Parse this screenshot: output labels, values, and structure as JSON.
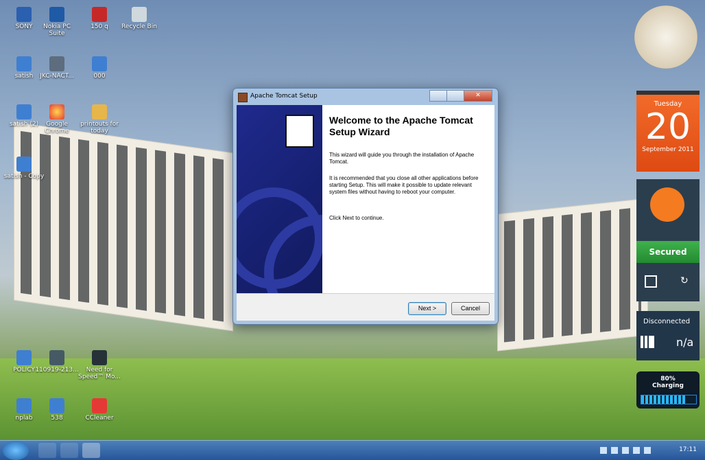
{
  "desktop_icons": [
    {
      "label": "SONY"
    },
    {
      "label": "Nokia PC\nSuite"
    },
    {
      "label": "150 q"
    },
    {
      "label": "Recycle Bin"
    },
    {
      "label": "satish"
    },
    {
      "label": "JKC-NACT..."
    },
    {
      "label": "000"
    },
    {
      "label": "satish (2)"
    },
    {
      "label": "Google\nChrome"
    },
    {
      "label": "printouts for\ntoday"
    },
    {
      "label": "satish - Copy"
    },
    {
      "label": "POLICY"
    },
    {
      "label": "110919-213..."
    },
    {
      "label": "Need for\nSpeed™ Mo..."
    },
    {
      "label": "nplab"
    },
    {
      "label": "538"
    },
    {
      "label": "CCleaner"
    }
  ],
  "dialog": {
    "title": "Apache Tomcat Setup",
    "heading": "Welcome to the Apache Tomcat Setup Wizard",
    "paragraphs": [
      "This wizard will guide you through the installation of Apache Tomcat.",
      "It is recommended that you close all other applications before starting Setup. This will make it possible to update relevant system files without having to reboot your computer.",
      "Click Next to continue."
    ],
    "buttons": {
      "next": "Next >",
      "cancel": "Cancel"
    }
  },
  "gadgets": {
    "calendar": {
      "weekday": "Tuesday",
      "day": "20",
      "month_year": "September 2011"
    },
    "avast": {
      "status": "Secured"
    },
    "network": {
      "status": "Disconnected",
      "value": "n/a"
    },
    "battery": {
      "percent": "80%",
      "state": "Charging",
      "level": 0.8
    }
  },
  "taskbar": {
    "time": "17:11"
  },
  "colors": {
    "tomcat_blue": "#1f2a8d",
    "calendar_orange": "#f26b2a",
    "avast_green": "#3fb14c"
  }
}
